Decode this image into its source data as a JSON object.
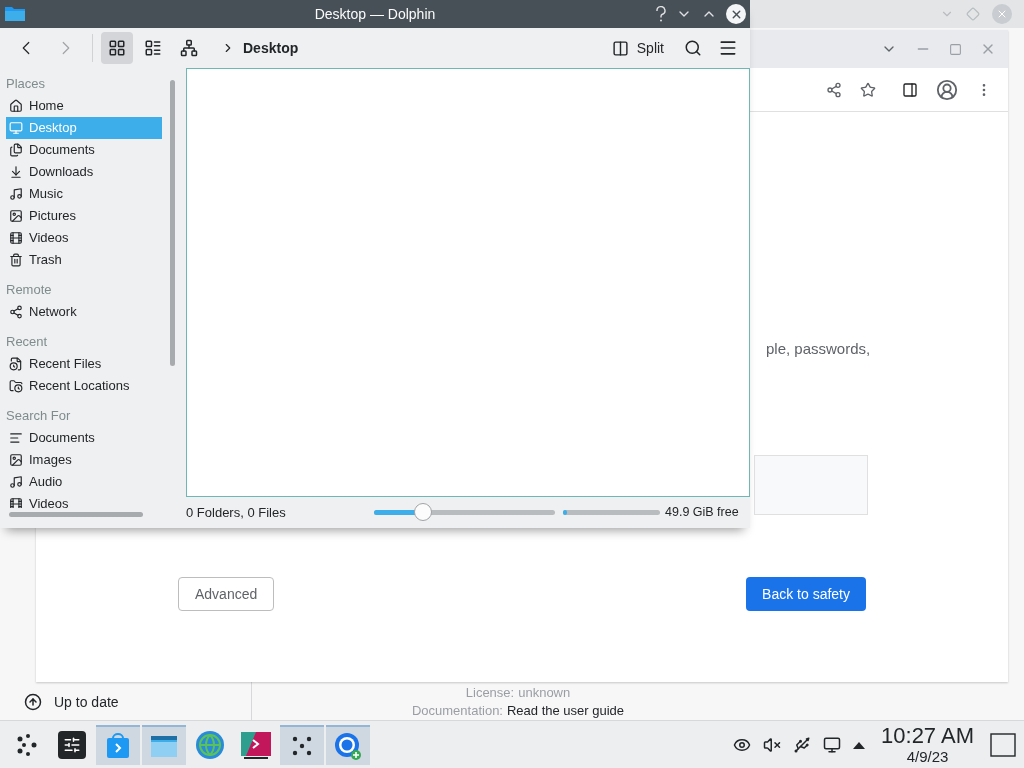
{
  "background_window": {
    "sidebar_items": [
      {
        "label": "Up to date"
      }
    ],
    "details": [
      {
        "label": "License:",
        "value": "unknown"
      },
      {
        "label": "Documentation:",
        "value": "Read the user guide"
      }
    ]
  },
  "browser": {
    "page_text": "ple, passwords,",
    "buttons": [
      {
        "label": "Advanced",
        "kind": "secondary"
      },
      {
        "label": "Back to safety",
        "kind": "primary"
      }
    ]
  },
  "dolphin": {
    "title": "Desktop — Dolphin",
    "view_modes": [
      {
        "kind": "icons",
        "selected": true
      },
      {
        "kind": "compact",
        "selected": false
      },
      {
        "kind": "details",
        "selected": false
      }
    ],
    "breadcrumb": "Desktop",
    "split_label": "Split",
    "sidebar": [
      {
        "heading": "Places",
        "items": [
          {
            "label": "Home",
            "selected": false
          },
          {
            "label": "Desktop",
            "selected": true
          },
          {
            "label": "Documents",
            "selected": false
          },
          {
            "label": "Downloads",
            "selected": false
          },
          {
            "label": "Music",
            "selected": false
          },
          {
            "label": "Pictures",
            "selected": false
          },
          {
            "label": "Videos",
            "selected": false
          },
          {
            "label": "Trash",
            "selected": false
          }
        ]
      },
      {
        "heading": "Remote",
        "items": [
          {
            "label": "Network",
            "selected": false
          }
        ]
      },
      {
        "heading": "Recent",
        "items": [
          {
            "label": "Recent Files",
            "selected": false
          },
          {
            "label": "Recent Locations",
            "selected": false
          }
        ]
      },
      {
        "heading": "Search For",
        "items": [
          {
            "label": "Documents",
            "selected": false
          },
          {
            "label": "Images",
            "selected": false
          },
          {
            "label": "Audio",
            "selected": false
          },
          {
            "label": "Videos",
            "selected": false
          }
        ]
      }
    ],
    "status": "0 Folders, 0 Files",
    "zoom": {
      "level": 0.27
    },
    "disk": {
      "level": 0.04,
      "reading": "49.9 GiB free"
    }
  },
  "taskbar": {
    "tasks": [
      {
        "active": false
      },
      {
        "active": false
      },
      {
        "active": true
      },
      {
        "active": true
      },
      {
        "active": false
      },
      {
        "active": false
      },
      {
        "active": true
      },
      {
        "active": true
      }
    ],
    "clock": {
      "time": "10:27 AM",
      "date": "4/9/23"
    }
  }
}
